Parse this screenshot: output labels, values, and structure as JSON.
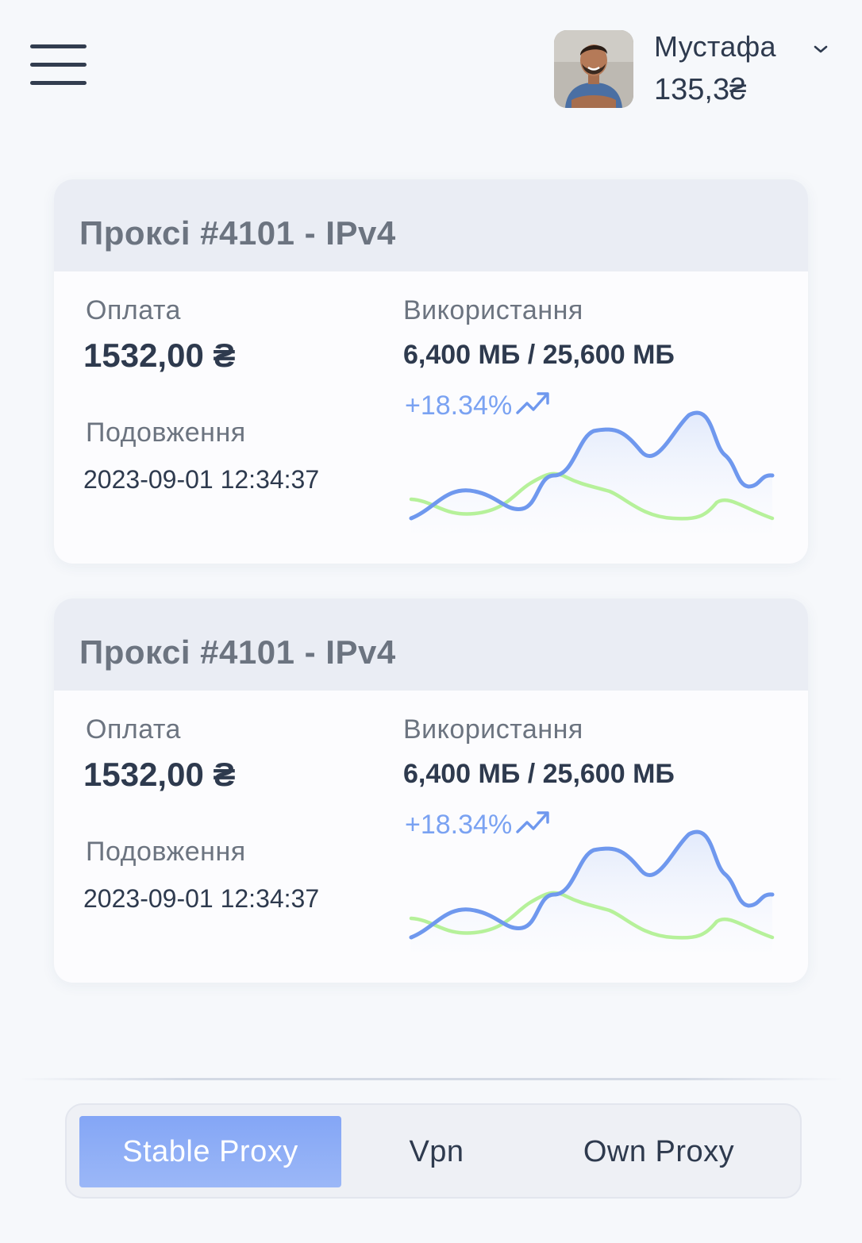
{
  "header": {
    "menu_icon": "hamburger-menu-icon",
    "user": {
      "name": "Мустафа",
      "balance": "135,3₴",
      "avatar_icon": "user-avatar"
    }
  },
  "cards": [
    {
      "title": "Проксі #4101 - IPv4",
      "payment_label": "Оплата",
      "payment_value": "1532,00 ₴",
      "usage_label": "Використання",
      "usage_value": "6,400 МБ / 25,600 МБ",
      "extension_label": "Подовження",
      "extension_value": "2023-09-01 12:34:37",
      "trend_percent": "+18.34%",
      "trend_icon": "trending-up-icon"
    },
    {
      "title": "Проксі #4101 - IPv4",
      "payment_label": "Оплата",
      "payment_value": "1532,00 ₴",
      "usage_label": "Використання",
      "usage_value": "6,400 МБ / 25,600 МБ",
      "extension_label": "Подовження",
      "extension_value": "2023-09-01 12:34:37",
      "trend_percent": "+18.34%",
      "trend_icon": "trending-up-icon"
    }
  ],
  "tabs": [
    {
      "label": "Stable Proxy",
      "active": true
    },
    {
      "label": "Vpn",
      "active": false
    },
    {
      "label": "Own Proxy",
      "active": false
    }
  ],
  "colors": {
    "accent": "#84a6f6",
    "sparkline_primary": "#6f98ee",
    "sparkline_secondary": "#b6f19a",
    "text_primary": "#2e3a4e",
    "text_muted": "#6c7480"
  }
}
